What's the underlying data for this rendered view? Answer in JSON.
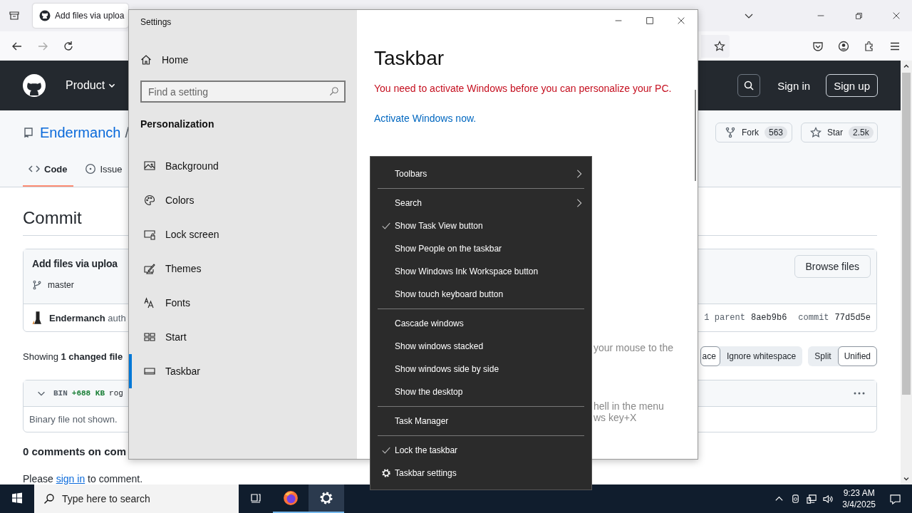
{
  "browser": {
    "tab_title": "Add files via uploa"
  },
  "github": {
    "header": {
      "nav_item": "Product",
      "sign_in": "Sign in",
      "sign_up": "Sign up"
    },
    "repo": {
      "owner": "Endermanch",
      "separator": "/",
      "actions": [
        {
          "kind": "fork",
          "label": "Fork",
          "count": "563"
        },
        {
          "kind": "star",
          "label": "Star",
          "count": "2.5k"
        }
      ],
      "tabs": [
        {
          "kind": "code",
          "label": "Code",
          "selected": true
        },
        {
          "kind": "issues",
          "label": "Issue",
          "selected": false
        }
      ]
    },
    "commit": {
      "heading": "Commit",
      "title": "Add files via uploa",
      "browse": "Browse files",
      "branch": "master",
      "author": "Endermanch",
      "authored": "auth",
      "parent_label": "1 parent",
      "parent_sha": "8aeb9b6",
      "commit_label": "commit",
      "commit_sha": "77d5d5e"
    },
    "diff_summary": "Showing **1 changed file**",
    "view_groups": [
      [
        {
          "label": "ace",
          "selected": true
        },
        {
          "label": "Ignore whitespace",
          "selected": false
        }
      ],
      [
        {
          "label": "Split",
          "selected": false
        },
        {
          "label": "Unified",
          "selected": true
        }
      ]
    ],
    "file": {
      "status": "BIN",
      "size": "+688 KB",
      "name": "rog",
      "note": "Binary file not shown."
    },
    "comments": {
      "heading": "0 comments on com",
      "prompt_before": "Please",
      "link": "sign in",
      "prompt_after": "to comment."
    }
  },
  "settings": {
    "title": "Settings",
    "home": "Home",
    "search": {
      "placeholder": "Find a setting"
    },
    "section": "Personalization",
    "nav": [
      {
        "kind": "background",
        "label": "Background",
        "selected": false
      },
      {
        "kind": "colors",
        "label": "Colors",
        "selected": false
      },
      {
        "kind": "lock",
        "label": "Lock screen",
        "selected": false
      },
      {
        "kind": "themes",
        "label": "Themes",
        "selected": false
      },
      {
        "kind": "fonts",
        "label": "Fonts",
        "selected": false
      },
      {
        "kind": "start",
        "label": "Start",
        "selected": false
      },
      {
        "kind": "taskbar",
        "label": "Taskbar",
        "selected": true
      }
    ],
    "heading": "Taskbar",
    "warning": "You need to activate Windows before you can personalize your PC.",
    "activate_link": "Activate Windows now.",
    "fragments": [
      "your mouse to the",
      "hell in the menu",
      "ws key+X"
    ]
  },
  "context_menu": {
    "groups": [
      [
        {
          "kind": "submenu",
          "label": "Toolbars"
        }
      ],
      [
        {
          "kind": "submenu",
          "label": "Search"
        },
        {
          "kind": "toggle",
          "label": "Show Task View button",
          "checked": true
        },
        {
          "kind": "toggle",
          "label": "Show People on the taskbar",
          "checked": false
        },
        {
          "kind": "toggle",
          "label": "Show Windows Ink Workspace button",
          "checked": false
        },
        {
          "kind": "toggle",
          "label": "Show touch keyboard button",
          "checked": false
        }
      ],
      [
        {
          "kind": "command",
          "label": "Cascade windows"
        },
        {
          "kind": "command",
          "label": "Show windows stacked"
        },
        {
          "kind": "command",
          "label": "Show windows side by side"
        },
        {
          "kind": "command",
          "label": "Show the desktop"
        }
      ],
      [
        {
          "kind": "command",
          "label": "Task Manager"
        }
      ],
      [
        {
          "kind": "toggle",
          "label": "Lock the taskbar",
          "checked": true
        },
        {
          "kind": "settings",
          "label": "Taskbar settings"
        }
      ]
    ]
  },
  "taskbar": {
    "search": {
      "placeholder": "Type here to search"
    },
    "apps": [
      {
        "kind": "firefox",
        "selected": false
      },
      {
        "kind": "settings",
        "selected": true
      }
    ],
    "time": "9:23 AM",
    "date": "3/4/2025"
  }
}
